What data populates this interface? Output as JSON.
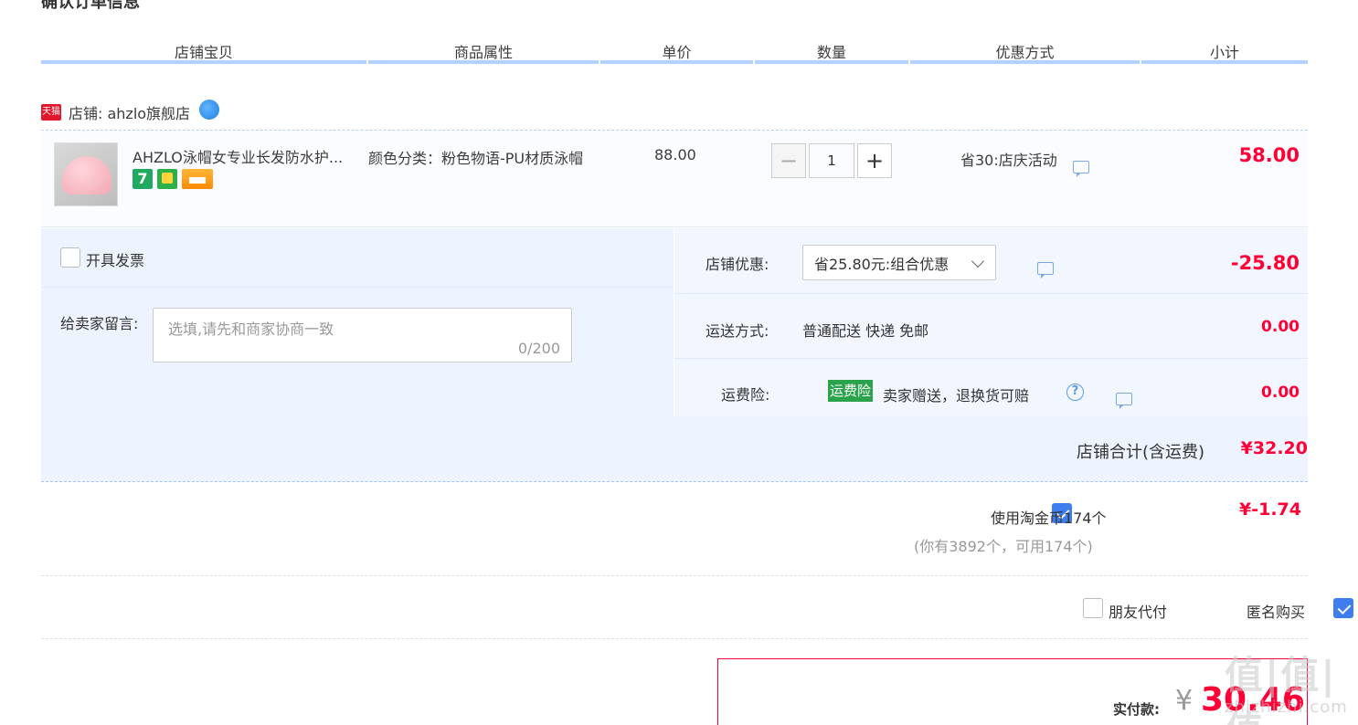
{
  "page": {
    "heading": "确认订单信息"
  },
  "columns": [
    "店铺宝贝",
    "商品属性",
    "单价",
    "数量",
    "优惠方式",
    "小计"
  ],
  "shop": {
    "badge": "天猫",
    "label": "店铺: ahzlo旗舰店"
  },
  "item": {
    "title": "AHZLO泳帽女专业长发防水护...",
    "attribute": "颜色分类：粉色物语-PU材质泳帽",
    "unit_price": "88.00",
    "quantity": "1",
    "minus": "−",
    "plus": "+",
    "promo": "省30:店庆活动",
    "subtotal": "58.00",
    "badge_7": "7"
  },
  "invoice": {
    "label": "开具发票"
  },
  "message": {
    "label": "给卖家留言:",
    "placeholder": "选填,请先和商家协商一致",
    "counter": "0/200"
  },
  "shop_discount": {
    "label": "店铺优惠:",
    "selected": "省25.80元:组合优惠",
    "amount": "-25.80"
  },
  "shipping": {
    "label": "运送方式:",
    "value": "普通配送 快递 免邮",
    "amount": "0.00"
  },
  "insurance": {
    "label": "运费险:",
    "badge": "运费险",
    "text": "卖家赠送，退换货可赔",
    "amount": "0.00",
    "help": "?"
  },
  "shop_total": {
    "label": "店铺合计(含运费)",
    "amount": "¥32.20"
  },
  "coins": {
    "label": "使用淘金币174个",
    "detail": "(你有3892个，可用174个)",
    "amount": "¥-1.74"
  },
  "options": {
    "friend_pay": "朋友代付",
    "anonymous": "匿名购买"
  },
  "payment": {
    "label": "实付款:",
    "currency": "¥",
    "amount": "30.46"
  },
  "watermark": {
    "main": "值|值|值",
    "sub": "zhizhizhi.com"
  },
  "colors": {
    "accent_blue": "#b2d1ff",
    "price_red": "#ff0036",
    "check_blue": "#3e7ded",
    "insurance_green": "#2ba34c"
  }
}
